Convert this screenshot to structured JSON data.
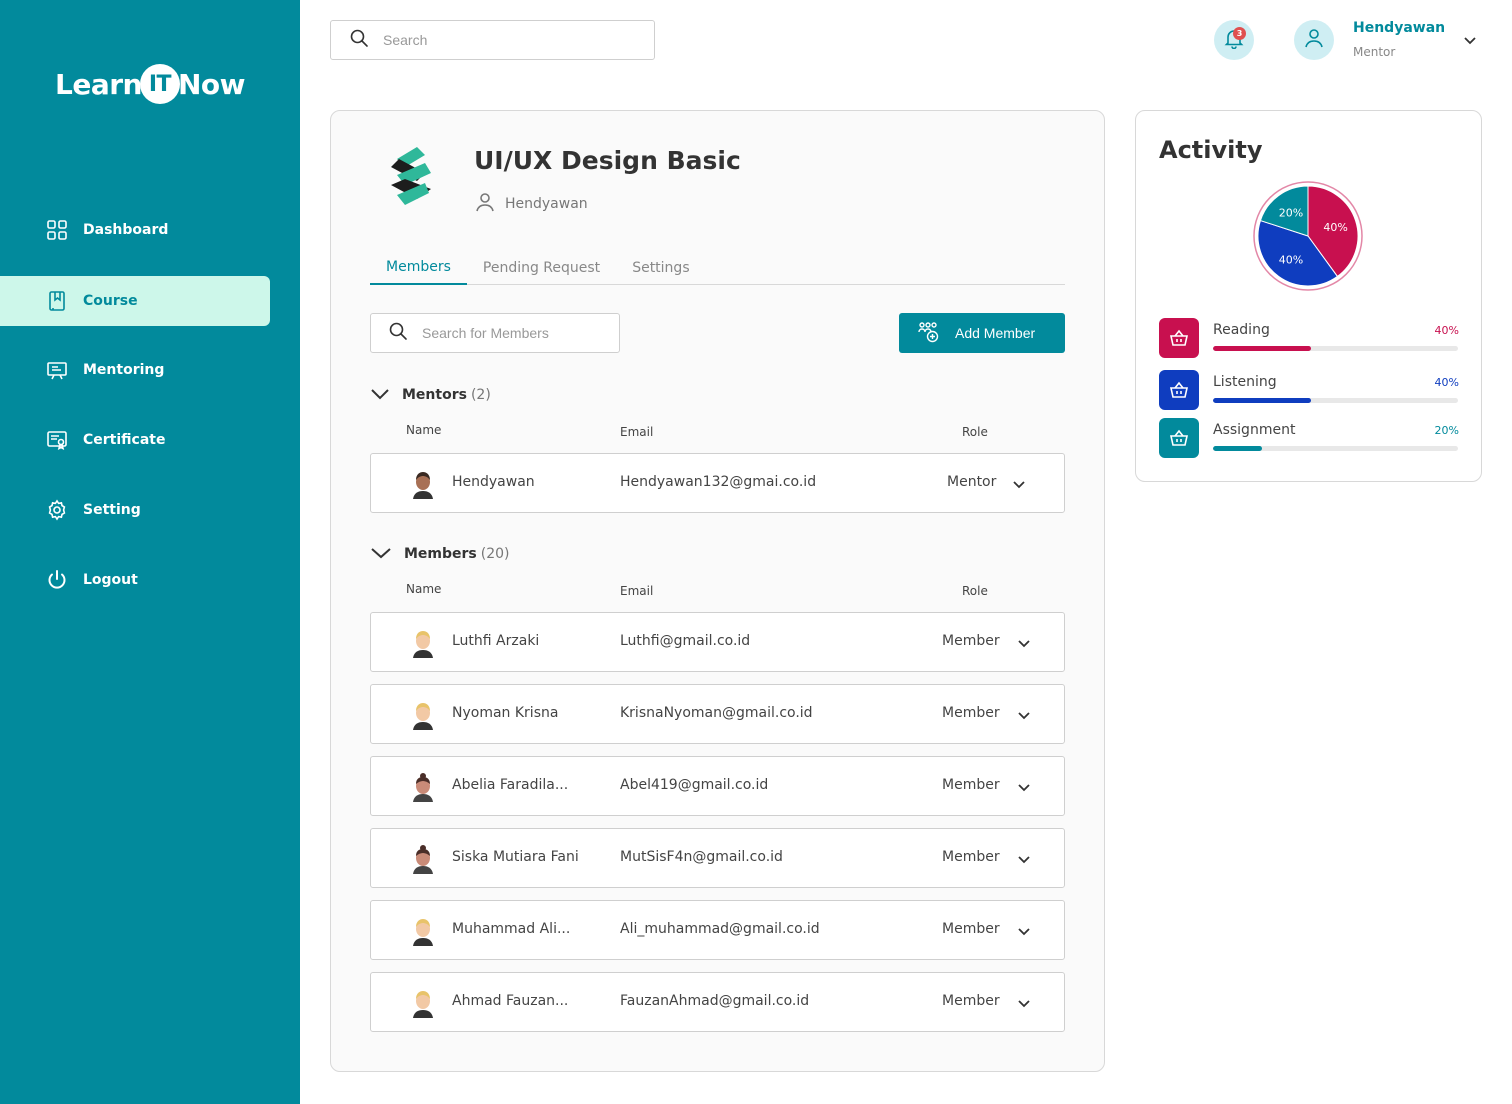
{
  "brand": {
    "pre": "Learn",
    "mid": "IT",
    "post": "Now"
  },
  "sidebar": {
    "items": [
      {
        "label": "Dashboard",
        "icon": "grid-icon",
        "active": false
      },
      {
        "label": "Course",
        "icon": "book-icon",
        "active": true
      },
      {
        "label": "Mentoring",
        "icon": "presentation-icon",
        "active": false
      },
      {
        "label": "Certificate",
        "icon": "certificate-icon",
        "active": false
      },
      {
        "label": "Setting",
        "icon": "gear-icon",
        "active": false
      },
      {
        "label": "Logout",
        "icon": "power-icon",
        "active": false
      }
    ]
  },
  "header": {
    "search_placeholder": "Search",
    "notification_count": "3",
    "user_name": "Hendyawan",
    "user_role": "Mentor"
  },
  "course": {
    "title": "UI/UX Design Basic",
    "mentor": "Hendyawan",
    "tabs": [
      "Members",
      "Pending Request",
      "Settings"
    ],
    "active_tab": "Members",
    "member_search_placeholder": "Search for Members",
    "add_member_label": "Add Member",
    "columns": {
      "name": "Name",
      "email": "Email",
      "role": "Role"
    },
    "mentors_section": {
      "label": "Mentors",
      "count": "(2)"
    },
    "mentors": [
      {
        "name": "Hendyawan",
        "email": "Hendyawan132@gmai.co.id",
        "role": "Mentor"
      }
    ],
    "members_section": {
      "label": "Members",
      "count": "(20)"
    },
    "members": [
      {
        "name": "Luthfi Arzaki",
        "email": "Luthfi@gmail.co.id",
        "role": "Member"
      },
      {
        "name": "Nyoman Krisna",
        "email": "KrisnaNyoman@gmail.co.id",
        "role": "Member"
      },
      {
        "name": "Abelia Faradila...",
        "email": "Abel419@gmail.co.id",
        "role": "Member"
      },
      {
        "name": "Siska Mutiara Fani",
        "email": "MutSisF4n@gmail.co.id",
        "role": "Member"
      },
      {
        "name": "Muhammad Ali...",
        "email": "Ali_muhammad@gmail.co.id",
        "role": "Member"
      },
      {
        "name": "Ahmad Fauzan...",
        "email": "FauzanAhmad@gmail.co.id",
        "role": "Member"
      }
    ]
  },
  "activity": {
    "title": "Activity",
    "items": [
      {
        "label": "Reading",
        "percent": "40%",
        "value": 0.4,
        "color": "#c8104f"
      },
      {
        "label": "Listening",
        "percent": "40%",
        "value": 0.4,
        "color": "#0f3dbf"
      },
      {
        "label": "Assignment",
        "percent": "20%",
        "value": 0.2,
        "color": "#028a9c"
      }
    ]
  },
  "colors": {
    "primary": "#028a9c",
    "active_bg": "#cdf7ea"
  }
}
